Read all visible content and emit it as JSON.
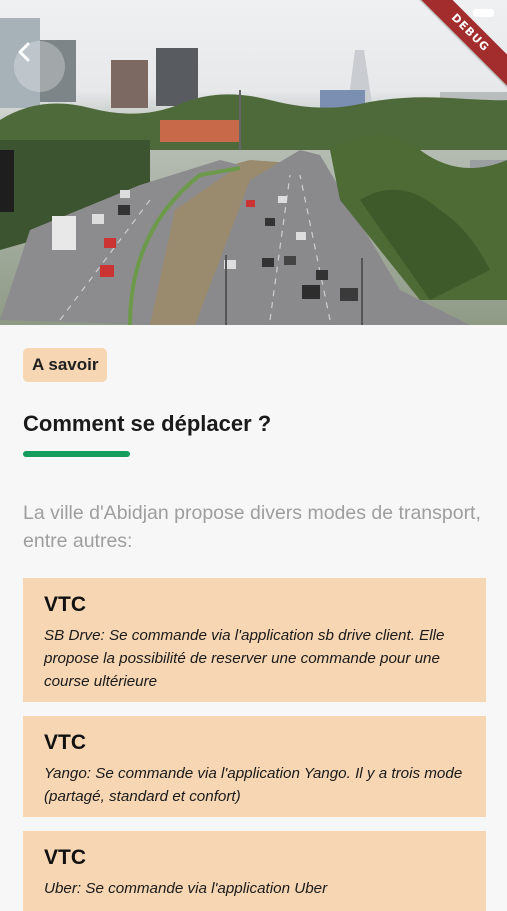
{
  "header": {
    "back_icon": "chevron-left-icon",
    "debug_banner": "DEBUG"
  },
  "section": {
    "badge": "A savoir",
    "title": "Comment se déplacer ?",
    "intro": "La ville d'Abidjan propose divers modes de transport, entre autres:"
  },
  "cards": [
    {
      "title": "VTC",
      "description": "SB Drve: Se commande via l'application sb drive client. Elle propose la possibilité de reserver une commande pour une course ultérieure"
    },
    {
      "title": "VTC",
      "description": "Yango: Se commande via l'application Yango. Il y a trois mode (partagé, standard et confort)"
    },
    {
      "title": "VTC",
      "description": "Uber: Se commande via l'application Uber"
    }
  ],
  "colors": {
    "accent_green": "#169c5e",
    "card_background": "#f7d6b3",
    "debug_red": "#a32c2c"
  }
}
